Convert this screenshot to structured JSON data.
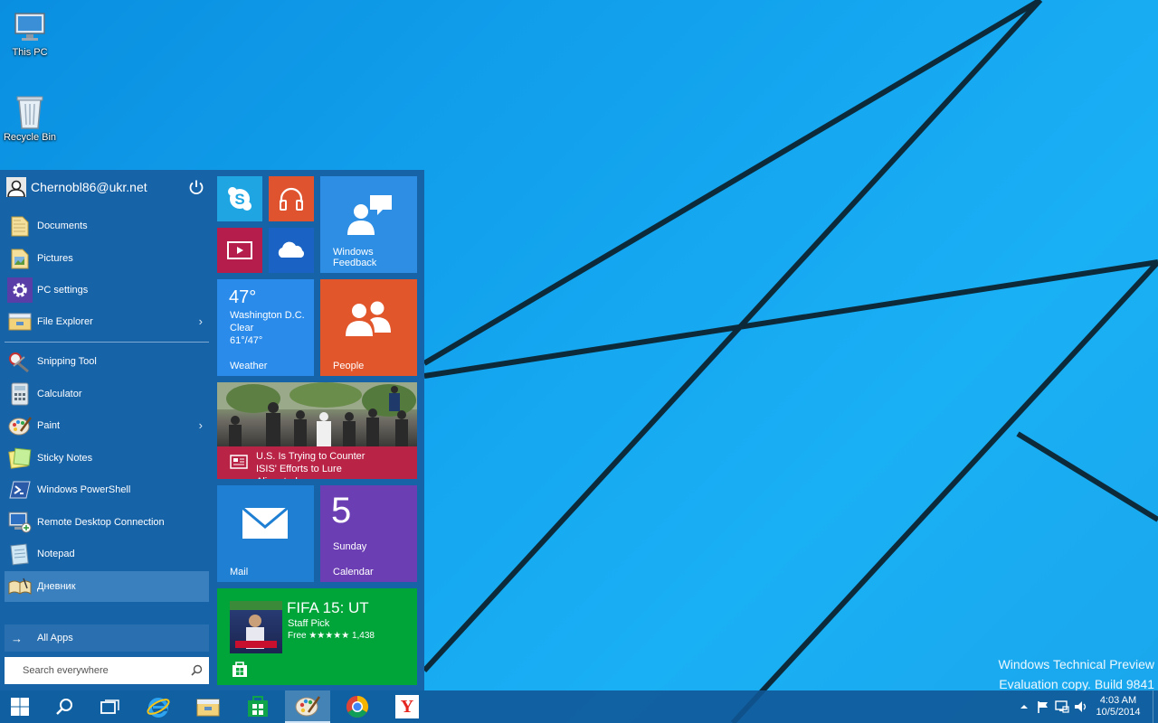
{
  "desktop": {
    "icons": [
      {
        "label": "This PC",
        "icon": "computer-icon"
      },
      {
        "label": "Recycle Bin",
        "icon": "recycle-bin-icon"
      }
    ],
    "watermark": {
      "line1": "Windows Technical Preview",
      "line2": "Evaluation copy. Build 9841"
    }
  },
  "start_menu": {
    "user": {
      "name": "Chernobl86@ukr.net",
      "icon": "user-icon",
      "power_icon": "power-icon"
    },
    "places": [
      {
        "label": "Documents",
        "icon": "documents-folder-icon"
      },
      {
        "label": "Pictures",
        "icon": "pictures-folder-icon"
      },
      {
        "label": "PC settings",
        "icon": "settings-gear-icon"
      },
      {
        "label": "File Explorer",
        "icon": "file-explorer-icon",
        "has_submenu": true
      }
    ],
    "apps": [
      {
        "label": "Snipping Tool",
        "icon": "snipping-tool-icon"
      },
      {
        "label": "Calculator",
        "icon": "calculator-icon"
      },
      {
        "label": "Paint",
        "icon": "paint-icon",
        "has_submenu": true
      },
      {
        "label": "Sticky Notes",
        "icon": "sticky-notes-icon"
      },
      {
        "label": "Windows PowerShell",
        "icon": "powershell-icon"
      },
      {
        "label": "Remote Desktop Connection",
        "icon": "remote-desktop-icon"
      },
      {
        "label": "Notepad",
        "icon": "notepad-icon"
      },
      {
        "label": "Дневник",
        "icon": "journal-icon",
        "selected": true
      }
    ],
    "submenu_arrow": "›",
    "all_apps": {
      "label": "All Apps",
      "arrow": "→"
    },
    "search": {
      "placeholder": "Search everywhere",
      "icon": "search-icon"
    },
    "tiles": {
      "skype": {
        "icon": "skype-icon",
        "color": "#1fa6e2"
      },
      "music": {
        "icon": "headphones-icon",
        "color": "#e0532f"
      },
      "video": {
        "icon": "video-icon",
        "color": "#b51d4d"
      },
      "onedrive": {
        "icon": "onedrive-cloud-icon",
        "color": "#1a63c5"
      },
      "feedback": {
        "label": "Windows Feedback",
        "icon": "feedback-icon",
        "color": "#2d8ee4"
      },
      "weather": {
        "temp": "47°",
        "city": "Washington D.C.",
        "condition": "Clear",
        "range": "61°/47°",
        "label": "Weather",
        "color": "#2a8bea"
      },
      "people": {
        "label": "People",
        "icon": "people-icon",
        "color": "#e2562b"
      },
      "news": {
        "headline": "U.S. Is Trying to Counter ISIS' Efforts to Lure Alienated...",
        "icon": "news-icon",
        "color": "#b82346"
      },
      "mail": {
        "label": "Mail",
        "icon": "mail-envelope-icon",
        "color": "#1f7fd3"
      },
      "calendar": {
        "day_num": "5",
        "day_name": "Sunday",
        "label": "Calendar",
        "color": "#6b3fb3"
      },
      "store": {
        "title": "FIFA 15: UT",
        "subtitle": "Staff Pick",
        "price": "Free ★★★★★ 1,438",
        "icon": "store-bag-icon",
        "color": "#00a53a"
      }
    }
  },
  "taskbar": {
    "buttons": [
      {
        "name": "start-button",
        "icon": "windows-logo-icon"
      },
      {
        "name": "search-button",
        "icon": "search-icon"
      },
      {
        "name": "task-view-button",
        "icon": "task-view-icon"
      },
      {
        "name": "internet-explorer-button",
        "icon": "internet-explorer-icon"
      },
      {
        "name": "file-explorer-button",
        "icon": "folder-icon"
      },
      {
        "name": "store-button",
        "icon": "store-bag-icon"
      },
      {
        "name": "paint-button",
        "icon": "paint-icon",
        "active": true
      },
      {
        "name": "chrome-button",
        "icon": "chrome-icon"
      },
      {
        "name": "yandex-button",
        "icon": "yandex-icon",
        "glyph": "Y"
      }
    ],
    "tray_icons": [
      "up-arrow-icon",
      "flag-icon",
      "network-icon",
      "volume-icon"
    ],
    "clock": {
      "time": "4:03 AM",
      "date": "10/5/2014"
    }
  }
}
